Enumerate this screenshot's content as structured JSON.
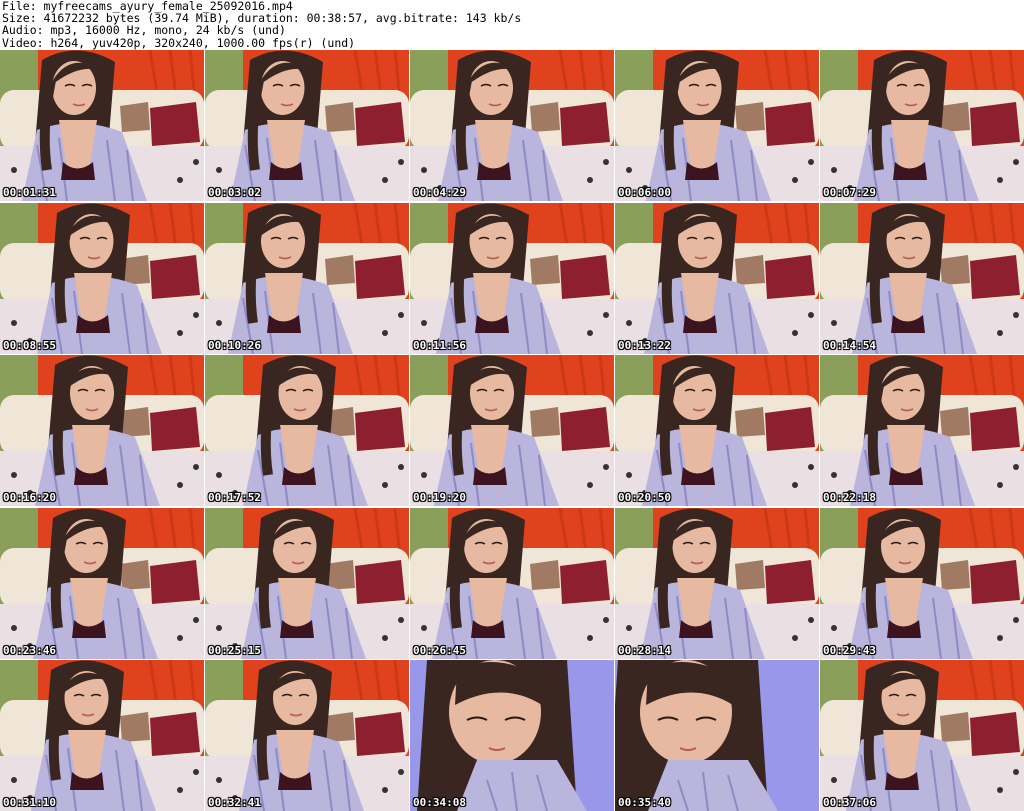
{
  "header": {
    "file_line": "File: myfreecams_ayury_female_25092016.mp4",
    "size_line": "Size: 41672232 bytes (39.74 MiB), duration: 00:38:57, avg.bitrate: 143 kb/s",
    "audio_line": "Audio: mp3, 16000 Hz, mono, 24 kb/s (und)",
    "video_line": "Video: h264, yuv420p, 320x240, 1000.00 fps(r) (und)"
  },
  "thumbnails": [
    {
      "timestamp": "00:01:31",
      "scene": "room"
    },
    {
      "timestamp": "00:03:02",
      "scene": "room"
    },
    {
      "timestamp": "00:04:29",
      "scene": "room"
    },
    {
      "timestamp": "00:06:00",
      "scene": "room"
    },
    {
      "timestamp": "00:07:29",
      "scene": "room"
    },
    {
      "timestamp": "00:08:55",
      "scene": "room"
    },
    {
      "timestamp": "00:10:26",
      "scene": "room"
    },
    {
      "timestamp": "00:11:56",
      "scene": "room"
    },
    {
      "timestamp": "00:13:22",
      "scene": "room"
    },
    {
      "timestamp": "00:14:54",
      "scene": "room"
    },
    {
      "timestamp": "00:16:20",
      "scene": "room"
    },
    {
      "timestamp": "00:17:52",
      "scene": "room"
    },
    {
      "timestamp": "00:19:20",
      "scene": "room"
    },
    {
      "timestamp": "00:20:50",
      "scene": "room"
    },
    {
      "timestamp": "00:22:18",
      "scene": "room"
    },
    {
      "timestamp": "00:23:46",
      "scene": "room"
    },
    {
      "timestamp": "00:25:15",
      "scene": "room"
    },
    {
      "timestamp": "00:26:45",
      "scene": "room"
    },
    {
      "timestamp": "00:28:14",
      "scene": "room"
    },
    {
      "timestamp": "00:29:43",
      "scene": "room"
    },
    {
      "timestamp": "00:31:10",
      "scene": "room"
    },
    {
      "timestamp": "00:32:41",
      "scene": "room"
    },
    {
      "timestamp": "00:34:08",
      "scene": "blue"
    },
    {
      "timestamp": "00:35:40",
      "scene": "blue"
    },
    {
      "timestamp": "00:37:06",
      "scene": "room"
    }
  ],
  "colors": {
    "curtain_red": "#e0421e",
    "curtain_green": "#8aa05a",
    "pillow_crimson": "#8e1f2e",
    "sofa_cream": "#efe6d8",
    "shirt_lavender": "#b9b5dc",
    "hair_dark": "#3a2621",
    "skin": "#e7b9a0",
    "blue_backdrop": "#8f8ee6"
  }
}
